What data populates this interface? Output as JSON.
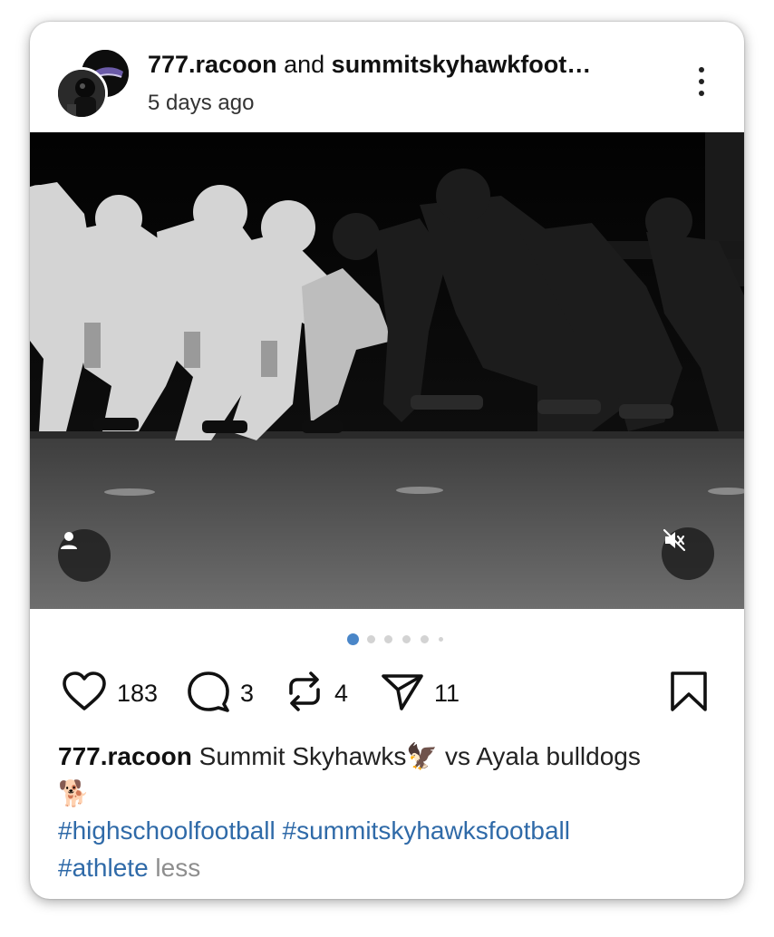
{
  "post": {
    "author_primary": "777.racoon",
    "joiner": "and",
    "author_secondary": "summitskyhawkfoot…",
    "time": "5 days ago"
  },
  "media": {
    "carousel_total": 6,
    "carousel_active_index": 0,
    "tag_icon": "person-icon",
    "mute_icon": "speaker-muted-icon"
  },
  "actions": {
    "likes": "183",
    "comments": "3",
    "reposts": "4",
    "shares": "11"
  },
  "caption": {
    "username": "777.racoon",
    "text_line1": "Summit Skyhawks🦅 vs Ayala bulldogs",
    "text_line2": "🐕",
    "hashtag1": "#highschoolfootball",
    "hashtag2": "#summitskyhawksfootball",
    "hashtag3": "#athlete",
    "less_label": "less"
  },
  "colors": {
    "accent_dot": "#4a86c8",
    "hashtag": "#2f6aa8",
    "muted_text": "#8e8e8e"
  }
}
